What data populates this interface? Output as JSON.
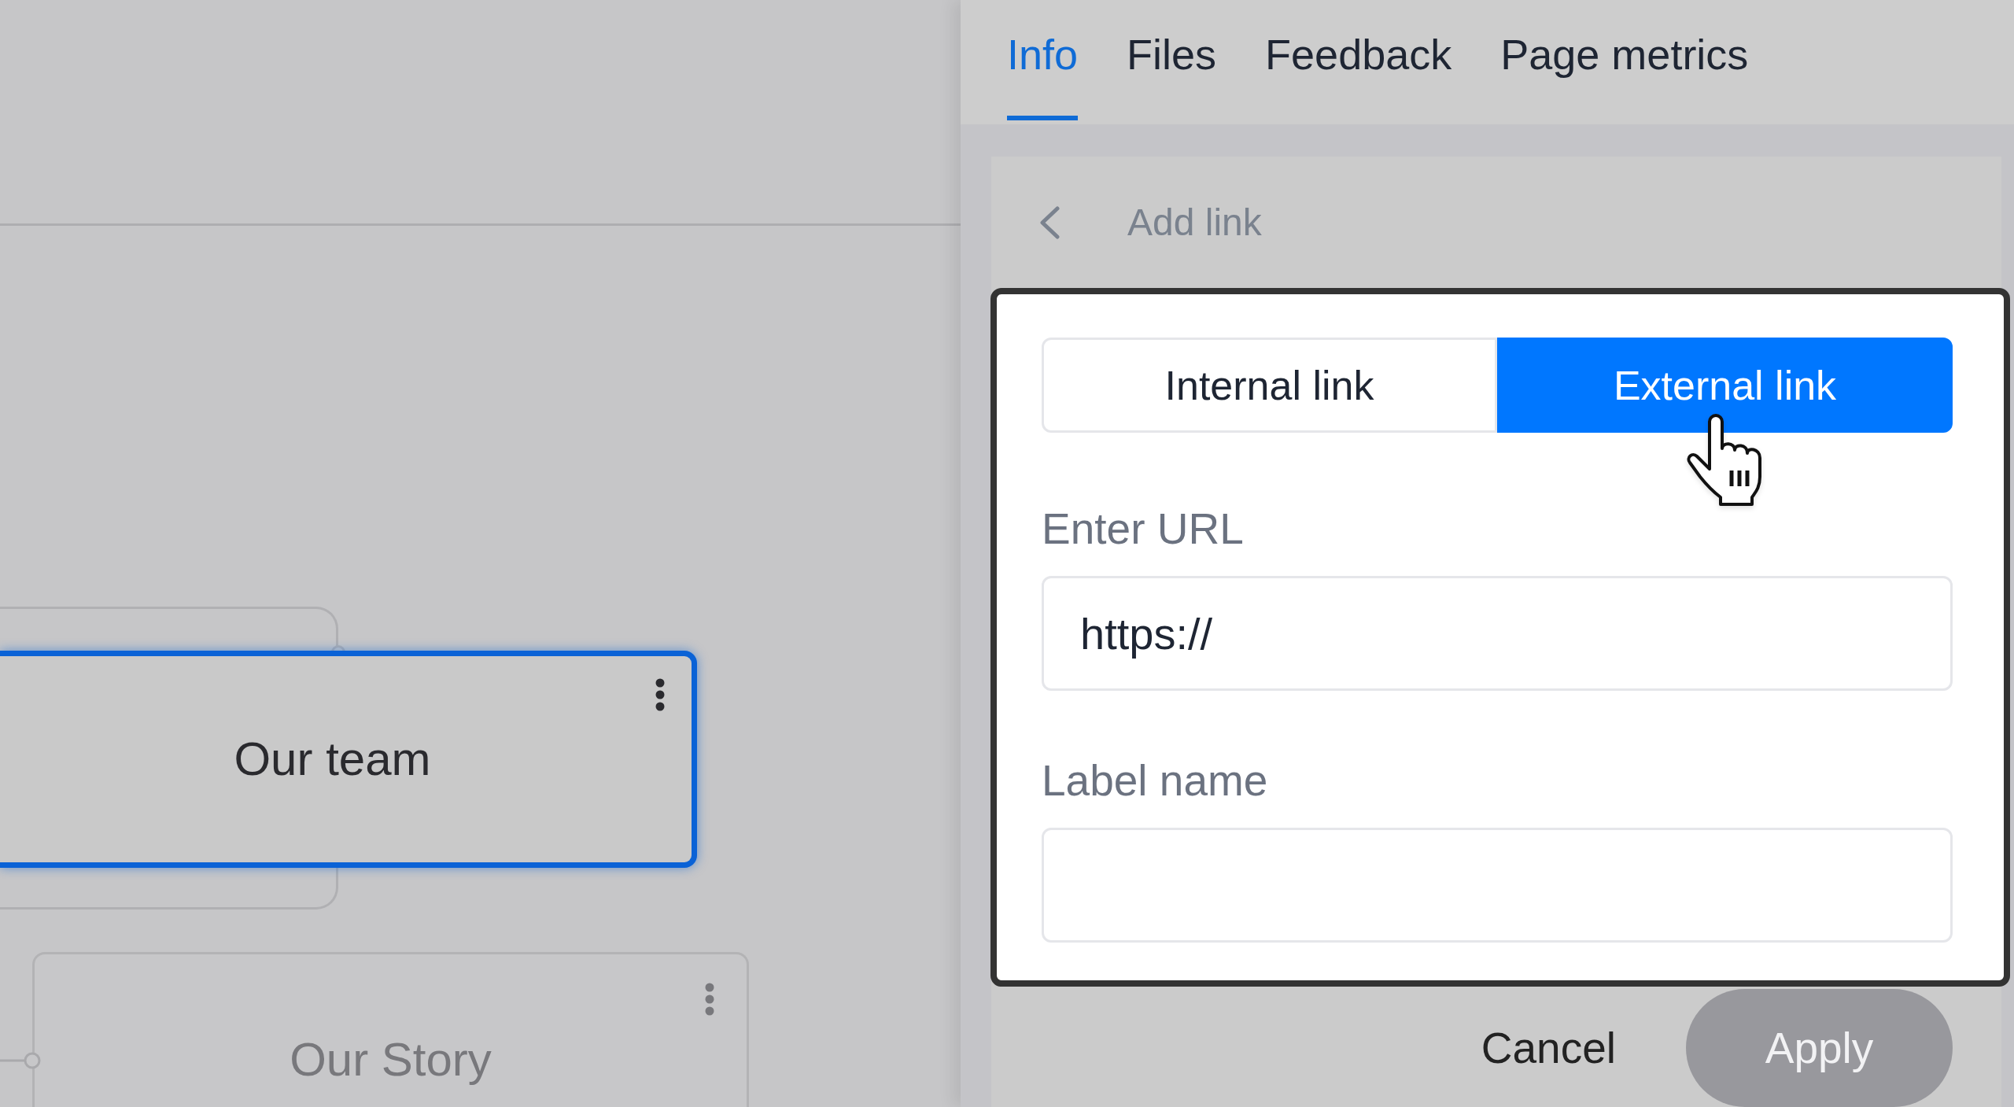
{
  "canvas": {
    "nodes": [
      {
        "label": "Our team",
        "selected": true
      },
      {
        "label": "Our Story",
        "selected": false
      }
    ]
  },
  "panel": {
    "tabs": [
      {
        "label": "Info",
        "selected": true
      },
      {
        "label": "Files",
        "selected": false
      },
      {
        "label": "Feedback",
        "selected": false
      },
      {
        "label": "Page metrics",
        "selected": false
      }
    ],
    "subpanel": {
      "title": "Add link",
      "link_type": [
        {
          "label": "Internal link",
          "selected": false
        },
        {
          "label": "External link",
          "selected": true
        }
      ],
      "fields": [
        {
          "label": "Enter URL",
          "value": "https://"
        },
        {
          "label": "Label name"
        }
      ],
      "buttons": [
        {
          "label": "Cancel",
          "kind": "text",
          "disabled": false
        },
        {
          "label": "Apply",
          "kind": "primary",
          "disabled": true
        }
      ]
    }
  }
}
